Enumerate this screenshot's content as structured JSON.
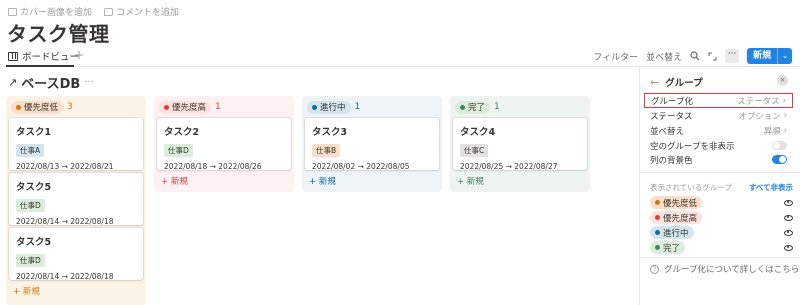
{
  "top_links": {
    "cover": "カバー画像を追加",
    "comment": "コメントを追加"
  },
  "page_title": "タスク管理",
  "view": {
    "tab_label": "ボードビュー",
    "add": "+"
  },
  "toolbar": {
    "filter": "フィルター",
    "sort": "並べ替え",
    "search_icon": "search-icon",
    "expand_icon": "expand-icon",
    "more": "···",
    "new_label": "新規",
    "new_arrow": "⌄"
  },
  "db": {
    "arrow": "↗",
    "title": "ベースDB",
    "dots": "···"
  },
  "columns": [
    {
      "label": "優先度低",
      "count": "3",
      "bg": "#fbf3e6",
      "pill_bg": "#fadec9",
      "dot": "#d9730d",
      "count_color": "#d9730d",
      "cards": [
        {
          "title": "タスク1",
          "tag": "仕事A",
          "tag_bg": "#d3e5ef",
          "date": "2022/08/13 → 2022/08/21"
        },
        {
          "title": "タスク5",
          "tag": "仕事D",
          "tag_bg": "#dbeddb",
          "date": "2022/08/14 → 2022/08/18"
        },
        {
          "title": "タスク5",
          "tag": "仕事D",
          "tag_bg": "#dbeddb",
          "date": "2022/08/14 → 2022/08/18"
        }
      ],
      "new_label": "+ 新規"
    },
    {
      "label": "優先度高",
      "count": "1",
      "bg": "#fdf2f1",
      "pill_bg": "#ffe2dd",
      "dot": "#e03e3e",
      "count_color": "#e03e3e",
      "cards": [
        {
          "title": "タスク2",
          "tag": "仕事D",
          "tag_bg": "#dbeddb",
          "date": "2022/08/18 → 2022/08/26"
        }
      ],
      "new_label": "+ 新規"
    },
    {
      "label": "進行中",
      "count": "1",
      "bg": "#eef4f8",
      "pill_bg": "#d3e5ef",
      "dot": "#0b6e99",
      "count_color": "#0b6e99",
      "cards": [
        {
          "title": "タスク3",
          "tag": "仕事B",
          "tag_bg": "#fadec9",
          "date": "2022/08/02 → 2022/08/05"
        }
      ],
      "new_label": "+ 新規"
    },
    {
      "label": "完了",
      "count": "1",
      "bg": "#eef5ef",
      "pill_bg": "#dbeddb",
      "dot": "#448361",
      "count_color": "#448361",
      "cards": [
        {
          "title": "タスク4",
          "tag": "仕事C",
          "tag_bg": "#e3e2e0",
          "date": "2022/08/25 → 2022/08/27"
        }
      ],
      "new_label": "+ 新規"
    }
  ],
  "panel": {
    "back": "←",
    "title": "グループ",
    "close": "×",
    "rows": [
      {
        "label": "グループ化",
        "value": "ステータス"
      },
      {
        "label": "ステータス",
        "value": "オプション"
      },
      {
        "label": "並べ替え",
        "value": "昇順"
      }
    ],
    "toggle_rows": [
      {
        "label": "空のグループを非表示",
        "state": "off"
      },
      {
        "label": "列の背景色",
        "state": "on"
      }
    ],
    "visible_groups_label": "表示されているグループ",
    "hide_all": "すべて非表示",
    "groups": [
      {
        "label": "優先度低",
        "pill_bg": "#fadec9",
        "dot": "#d9730d"
      },
      {
        "label": "優先度高",
        "pill_bg": "#ffe2dd",
        "dot": "#e03e3e"
      },
      {
        "label": "進行中",
        "pill_bg": "#d3e5ef",
        "dot": "#0b6e99"
      },
      {
        "label": "完了",
        "pill_bg": "#dbeddb",
        "dot": "#448361"
      }
    ],
    "help": "グループ化について詳しくはこちら"
  },
  "colors": {
    "accent": "#2383e2",
    "highlight_border": "#e03e3e"
  }
}
